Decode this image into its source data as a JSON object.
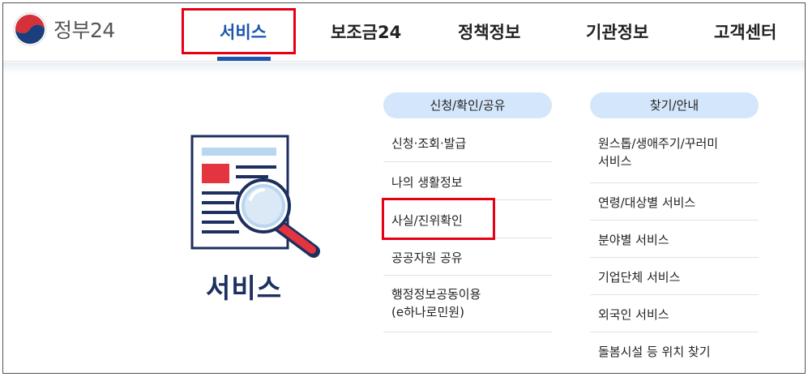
{
  "header": {
    "logo_text": "정부24",
    "nav": [
      "서비스",
      "보조금24",
      "정책정보",
      "기관정보",
      "고객센터"
    ]
  },
  "service": {
    "title": "서비스"
  },
  "menu": {
    "column_a": {
      "heading": "신청/확인/공유",
      "items": [
        "신청·조회·발급",
        "나의 생활정보",
        "사실/진위확인",
        "공공자원 공유",
        "행정정보공동이용\n(e하나로민원)"
      ]
    },
    "column_b": {
      "heading": "찾기/안내",
      "items": [
        "원스톱/생애주기/꾸러미\n서비스",
        "연령/대상별 서비스",
        "분야별 서비스",
        "기업단체 서비스",
        "외국인 서비스",
        "돌봄시설 등 위치 찾기"
      ]
    }
  },
  "colors": {
    "accent": "#1a56b0",
    "highlight": "#e60012",
    "pill": "#d4e6fb"
  }
}
